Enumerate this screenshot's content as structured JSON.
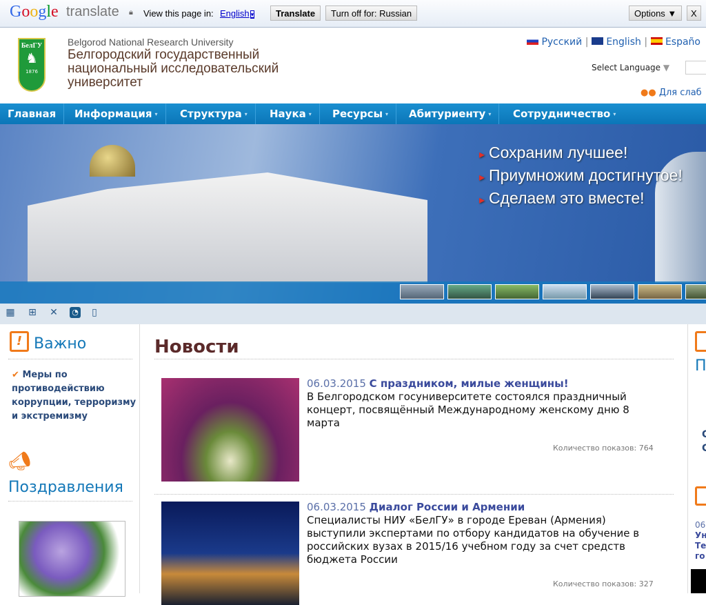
{
  "translate_bar": {
    "logo_google": "Google",
    "logo_translate": "translate",
    "view_label": "View this page in:",
    "language": "English",
    "translate_button": "Translate",
    "turn_off_button": "Turn off for: Russian",
    "options_button": "Options ▼",
    "close": "X"
  },
  "header": {
    "logo_text": "БелГУ",
    "logo_year": "1876",
    "subtitle_en": "Belgorod National Research University",
    "title_line1": "Белгородский государственный",
    "title_line2": "национальный исследовательский",
    "title_line3": "университет",
    "languages": [
      "Русский",
      "English",
      "Españo"
    ],
    "select_language": "Select Language",
    "accessibility": "Для слаб"
  },
  "nav": [
    {
      "label": "Главная"
    },
    {
      "label": "Информация"
    },
    {
      "label": "Структура"
    },
    {
      "label": "Наука"
    },
    {
      "label": "Ресурсы"
    },
    {
      "label": "Абитуриенту"
    },
    {
      "label": "Сотрудничество"
    }
  ],
  "banner": {
    "lines": [
      "Сохраним лучшее!",
      "Приумножим достигнутое!",
      "Сделаем это вместе!"
    ]
  },
  "toolbar_icons": [
    "buildings-icon",
    "sitemap-icon",
    "tools-icon",
    "rss-icon",
    "mobile-icon"
  ],
  "left": {
    "important_title": "Важно",
    "important_link": "Меры по противодействию коррупции, терроризму и экстремизму",
    "congrats_title": "Поздравления"
  },
  "news": {
    "title": "Новости",
    "items": [
      {
        "date": "06.03.2015",
        "title": "С праздником, милые женщины!",
        "text": "В Белгородском госуниверситете состоялся праздничный концерт, посвящённый Международному женскому дню 8 марта",
        "views": "Количество показов: 764"
      },
      {
        "date": "06.03.2015",
        "title": "Диалог России и Армении",
        "text": "Специалисты НИУ «БелГУ» в городе Ереван (Армения) выступили экспертами по отбору кандидатов на обучение в российских вузах в 2015/16 учебном году за счет средств бюджета России",
        "views": "Количество показов: 327"
      }
    ]
  },
  "right": {
    "title_partial": "П",
    "item_date_partial": "06",
    "item_lines_partial": [
      "Ун",
      "Те",
      "го"
    ],
    "link_partial": [
      "С",
      "С"
    ]
  },
  "colors": {
    "nav": "#0b76b8",
    "heading": "#1478b8",
    "news_title": "#5b2a2a",
    "accent": "#f07a1a"
  }
}
